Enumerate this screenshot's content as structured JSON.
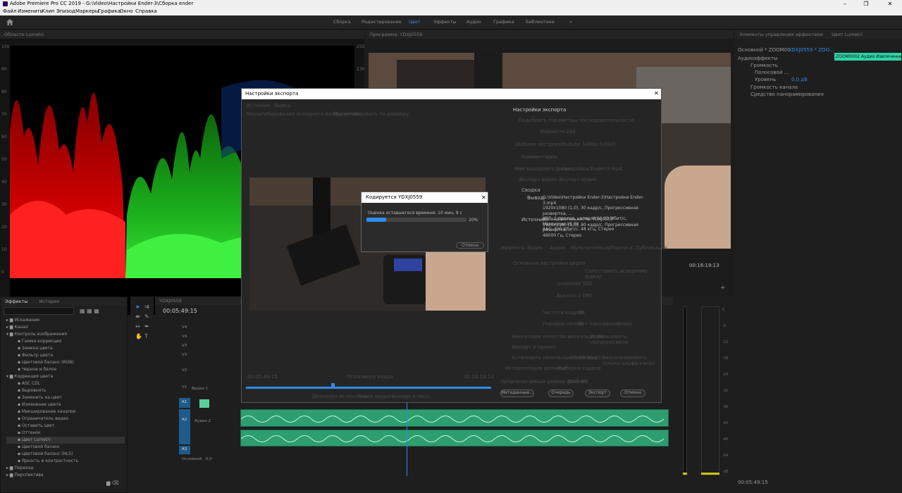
{
  "window": {
    "title": "Adobe Premiere Pro CC 2019 - G:\\Video\\Настройки Ender-3\\Сборка ender",
    "minimize": "–",
    "maximize": "❐",
    "close": "✕"
  },
  "menu": [
    "Файл",
    "Изменить",
    "Клип",
    "Эпизод",
    "Маркеры",
    "Графика",
    "Окно",
    "Справка"
  ],
  "workspaces": [
    "Сборка",
    "Редактирование",
    "Цвет",
    "Эффекты",
    "Аудио",
    "Графика",
    "Библиотеки"
  ],
  "workspace_active": "Цвет",
  "workspace_more": "»",
  "scope": {
    "tab": "Области Lumetri",
    "left_ticks": [
      "100",
      "90",
      "80",
      "70",
      "60",
      "50",
      "40",
      "30",
      "20",
      "10",
      "0"
    ],
    "right_ticks": [
      "255",
      "230",
      "204",
      "178",
      "153",
      "128",
      "102",
      "76",
      "51",
      "26",
      "0"
    ]
  },
  "program": {
    "tab": "Программа: YDXJ0559",
    "timecode": "00:16:19:13"
  },
  "effects_panel": {
    "tabs": [
      "Эффекты",
      "История"
    ],
    "items": [
      {
        "label": "Искажение",
        "level": 1
      },
      {
        "label": "Канал",
        "level": 1
      },
      {
        "label": "Контроль изображения",
        "level": 1,
        "open": true
      },
      {
        "label": "Гамма-коррекция",
        "level": 2
      },
      {
        "label": "Замена цвета",
        "level": 2
      },
      {
        "label": "Фильтр цвета",
        "level": 2
      },
      {
        "label": "Цветовой баланс (RGB)",
        "level": 2
      },
      {
        "label": "Черное и белое",
        "level": 2
      },
      {
        "label": "Коррекция цвета",
        "level": 1,
        "open": true
      },
      {
        "label": "ASC CDL",
        "level": 2
      },
      {
        "label": "Выровнять",
        "level": 2
      },
      {
        "label": "Заменить на цвет",
        "level": 2
      },
      {
        "label": "Изменение цвета",
        "level": 2
      },
      {
        "label": "Микширование каналов",
        "level": 2
      },
      {
        "label": "Ограничитель видео",
        "level": 2
      },
      {
        "label": "Оставить цвет",
        "level": 2
      },
      {
        "label": "Оттенок",
        "level": 2
      },
      {
        "label": "Цвет Lumetri",
        "level": 2,
        "selected": true
      },
      {
        "label": "Цветовой баланс",
        "level": 2
      },
      {
        "label": "Цветовой баланс (HLS)",
        "level": 2
      },
      {
        "label": "Яркость и контрастность",
        "level": 2
      },
      {
        "label": "Переход",
        "level": 1
      },
      {
        "label": "Перспектива",
        "level": 1
      }
    ]
  },
  "timeline": {
    "tab": "YDXJ0559",
    "timecode": "00:05:49:15",
    "tracks": [
      "V4",
      "V4",
      "V3",
      "V3",
      "V2",
      "V1",
      "A1",
      "A2",
      "A3"
    ],
    "track_names": {
      "v1": "Видео 1",
      "a2": "Аудио 2",
      "master": "Основной"
    },
    "master_value": "0,0"
  },
  "essential": {
    "tabs": [
      "Элементы управления эффектами",
      "Цвет Lumetri"
    ],
    "source": "Основной * ZOOM00...",
    "sequence": "YDXJ0559 * ZOO...",
    "clip_label": "ZOOM0002 Аудио Извлеченные",
    "audio_effects": "Аудиоэффекты",
    "volume": "Громкость",
    "bypass": "Полосовой ...",
    "level": "Уровень",
    "level_value": "0,0 дБ",
    "channel_volume": "Громкость канала",
    "panner": "Средство панорамирования",
    "timecode": "00:05:49:15"
  },
  "export": {
    "title": "Настройки экспорта",
    "tabs": [
      "Источник",
      "Вывод"
    ],
    "source_scaling_label": "Масштабирование исходного изображения",
    "source_scaling_value": "Масштабировать по размеру",
    "settings_header": "Настройки экспорта",
    "match_sequence": "Подобрать параметры последовательности",
    "format_label": "Формат:",
    "format_value": "H.264",
    "preset_label": "Шаблон настроек:",
    "preset_value": "Youtube 1080p FullHD",
    "comment_label": "Комментарии:",
    "output_name_label": "Имя выходного файла:",
    "output_name_value": "Настройки Ender-3.mp4",
    "export_video": "Экспорт видео",
    "export_audio": "Экспорт аудио",
    "summary_header": "Сводка",
    "output_label": "Вывод:",
    "output_text": "G:\\Video\\Настройки Ender-3\\Настройки Ender-3.mp4\n1920x1080 (1,0), 30 кадр/с, Прогрессивная развертка, ...\nVBR, 1 проход, целевой 16,00 Мбит/с, Максимум 16,00 ...\nААС, 320 Кбит/с, 48 кГц, Стерео",
    "source_label": "Источник:",
    "source_text": "Последовательность, YDXJ0559\n1920x1080 (1,0), 30 кадр/с, Прогрессивная развертка, ...\n48000 Гц, Стерео",
    "sub_tabs": [
      "Эффекты",
      "Видео",
      "Аудио",
      "Мультиплексор",
      "Подписи",
      "Публикация"
    ],
    "basic_video": "Основные настройки видео",
    "match_source_btn": "Сопоставить исходному файлу",
    "width_label": "Ширина:",
    "width_value": "1 920",
    "height_label": "Высота:",
    "height_value": "1 080",
    "fps_label": "Частота кадров:",
    "fps_value": "30",
    "field_order_label": "Порядок полей:",
    "field_order_value": "Нет (прогрессивная)",
    "max_render": "Наилучшее качество визуализации",
    "use_previews": "Использовать предпросмотр",
    "import_project": "Импорт в проект",
    "set_start_tc": "Установить начальный тайм-код",
    "start_tc_value": "00:00:00:00",
    "alpha_only": "Визуализировать только альфа-канал",
    "interpolation_label": "Интерполяция времени:",
    "interpolation_value": "Выборка кадров",
    "filesize_label": "Предполагаемый размер файла:",
    "filesize_value": "2905 МБ",
    "buttons": [
      "Метаданные...",
      "Очередь",
      "Экспорт",
      "Отмена"
    ],
    "tc_start": "00:05:49:15",
    "tc_end": "00:16:19:13",
    "fit": "По размеру кадра",
    "range_label": "Диапазон источника:",
    "range_value": "Точки входа/выхода в посл..."
  },
  "encode": {
    "title": "Кодируется YDXJ0559",
    "estimate": "Оценка оставшегося времени: 10 мин, 9 с",
    "progress": 0.2,
    "progress_label": "20%",
    "cancel": "Отмена"
  },
  "meter_ticks": [
    "0",
    "-6",
    "-12",
    "-18",
    "-24",
    "-30",
    "-36",
    "-42",
    "-48",
    "-54",
    "-dB"
  ]
}
